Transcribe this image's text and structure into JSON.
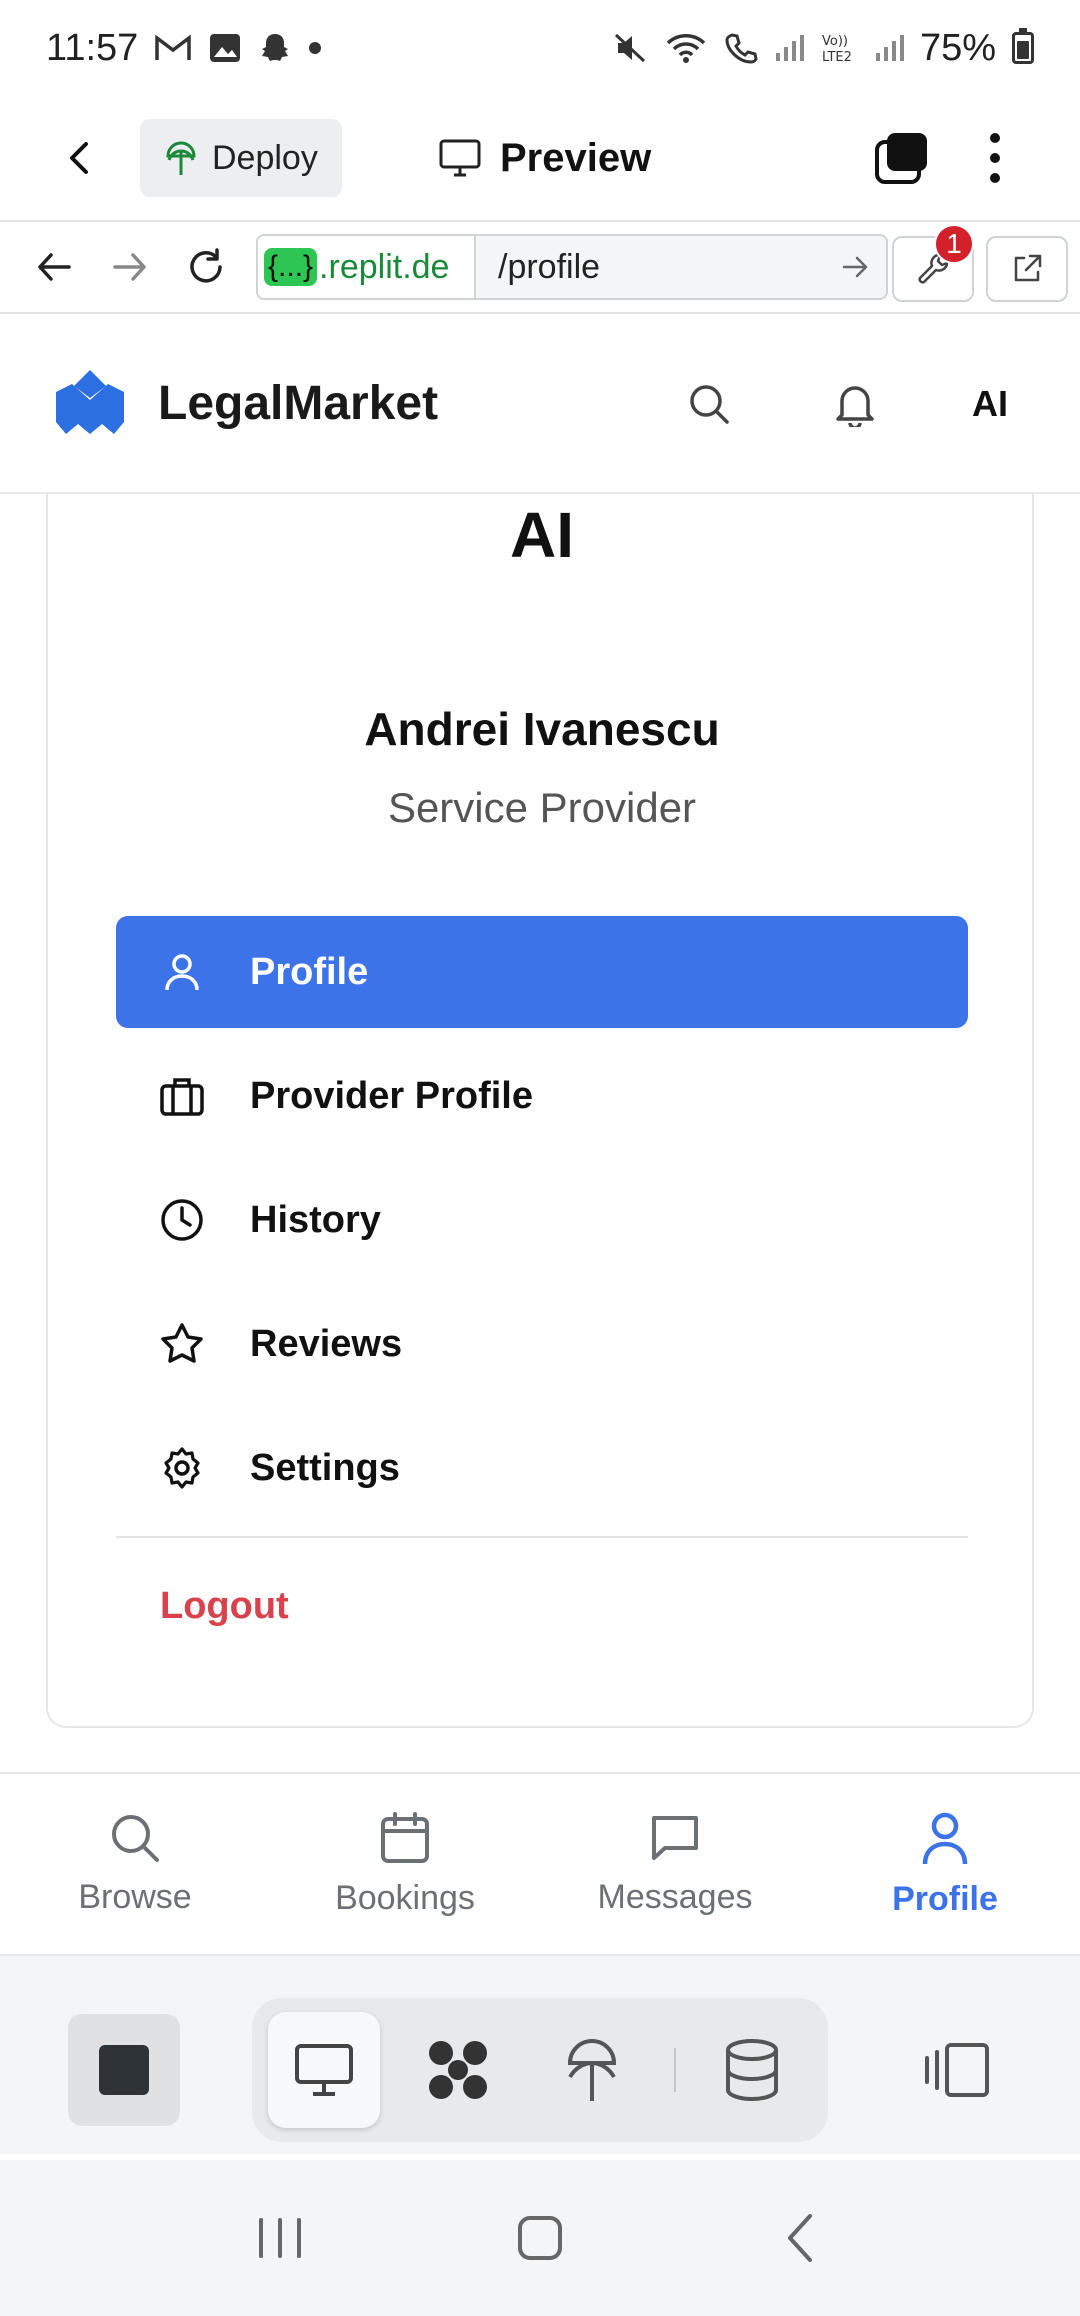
{
  "status_bar": {
    "time": "11:57",
    "battery": "75%"
  },
  "replit_header": {
    "deploy_label": "Deploy",
    "preview_label": "Preview"
  },
  "url_bar": {
    "host_badge": "{...}",
    "host": ".replit.de",
    "path": "/profile",
    "notification_count": "1"
  },
  "app_header": {
    "brand": "LegalMarket",
    "avatar_initials": "AI"
  },
  "profile": {
    "avatar_initials": "AI",
    "name": "Andrei Ivanescu",
    "role": "Service Provider"
  },
  "menu": {
    "items": [
      {
        "label": "Profile",
        "icon": "user-icon",
        "active": true
      },
      {
        "label": "Provider Profile",
        "icon": "briefcase-icon",
        "active": false
      },
      {
        "label": "History",
        "icon": "clock-icon",
        "active": false
      },
      {
        "label": "Reviews",
        "icon": "star-icon",
        "active": false
      },
      {
        "label": "Settings",
        "icon": "gear-icon",
        "active": false
      }
    ],
    "logout_label": "Logout"
  },
  "bottom_nav": {
    "tabs": [
      {
        "label": "Browse",
        "icon": "search-icon",
        "active": false
      },
      {
        "label": "Bookings",
        "icon": "calendar-icon",
        "active": false
      },
      {
        "label": "Messages",
        "icon": "message-icon",
        "active": false
      },
      {
        "label": "Profile",
        "icon": "user-icon",
        "active": true
      }
    ]
  },
  "colors": {
    "accent": "#3c73e9",
    "logout": "#d9414c",
    "url_host": "#1a8a3a"
  }
}
